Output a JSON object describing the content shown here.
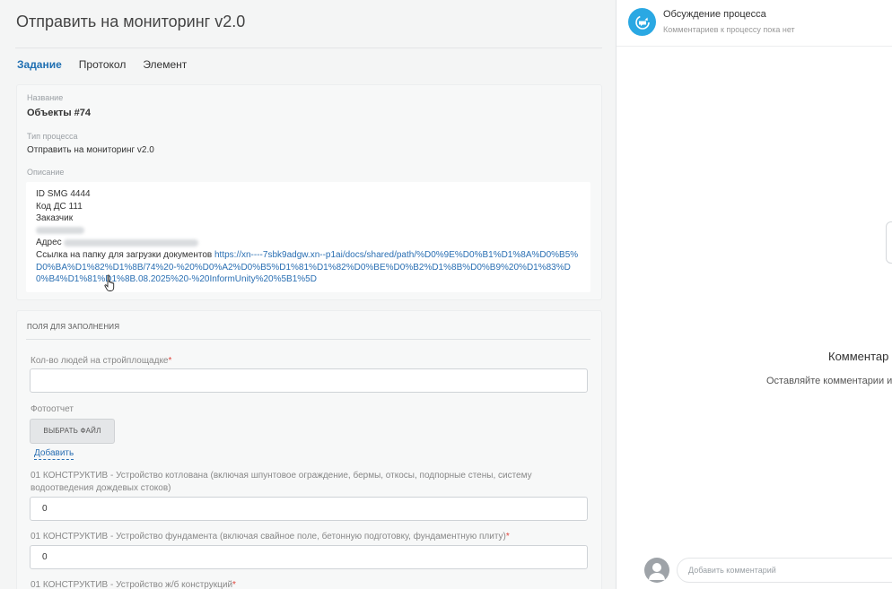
{
  "page": {
    "title": "Отправить на мониторинг v2.0"
  },
  "tabs": [
    {
      "label": "Задание",
      "active": true
    },
    {
      "label": "Протокол",
      "active": false
    },
    {
      "label": "Элемент",
      "active": false
    }
  ],
  "info": {
    "name_label": "Название",
    "name_value": "Объекты #74",
    "type_label": "Тип процесса",
    "type_value": "Отправить на мониторинг v2.0",
    "desc_label": "Описание",
    "desc_lines": {
      "l1": "ID SMG 4444",
      "l2": "Код ДС 111",
      "l3": "Заказчик",
      "l5": "Адрес",
      "link_prefix": "Ссылка на папку для загрузки документов ",
      "link_url": "https://xn----7sbk9adgw.xn--p1ai/docs/shared/path/%D0%9E%D0%B1%D1%8A%D0%B5%D0%BA%D1%82%D1%8B/74%20-%20%D0%A2%D0%B5%D1%81%D1%82%D0%BE%D0%B2%D1%8B%D0%B9%20%D1%83%D0%B4%D1%81%D1%8B.08.2025%20-%20InformUnity%20%5B1%5D"
    }
  },
  "form": {
    "section_title": "ПОЛЯ ДЛЯ ЗАПОЛНЕНИЯ",
    "people_label": "Кол-во людей на стройплощадке",
    "people_value": "",
    "photo_label": "Фотоотчет",
    "file_button": "ВЫБРАТЬ ФАЙЛ",
    "add_link": "Добавить",
    "f1_label": "01 КОНСТРУКТИВ - Устройство котлована (включая шпунтовое ограждение, бермы, откосы, подпорные стены, систему водоотведения дождевых стоков)",
    "f1_value": "0",
    "f2_label": "01 КОНСТРУКТИВ - Устройство фундамента (включая свайное поле, бетонную подготовку, фундаментную плиту)",
    "f2_value": "0",
    "f3_label": "01 КОНСТРУКТИВ - Устройство ж/б конструкций",
    "required_mark": "*"
  },
  "discussion": {
    "title": "Обсуждение процесса",
    "subtitle": "Комментариев к процессу пока нет",
    "empty_title": "Комментар",
    "empty_sub": "Оставляйте комментарии и",
    "comment_placeholder": "Добавить комментарий"
  },
  "colors": {
    "accent": "#1f6fb2",
    "link": "#2a6fb3",
    "discussion_icon": "#2aa8e3",
    "required": "#e0443b"
  }
}
